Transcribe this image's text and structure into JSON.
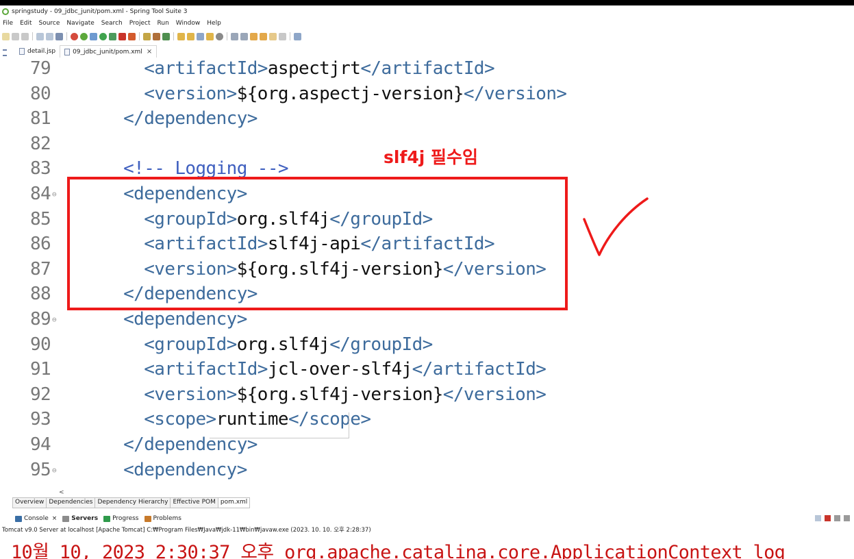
{
  "window": {
    "title": "springstudy - 09_jdbc_junit/pom.xml - Spring Tool Suite 3"
  },
  "menu": [
    "File",
    "Edit",
    "Source",
    "Navigate",
    "Search",
    "Project",
    "Run",
    "Window",
    "Help"
  ],
  "editor_tabs": [
    {
      "label": "detail.jsp",
      "active": false,
      "closable": false
    },
    {
      "label": "09_jdbc_junit/pom.xml",
      "active": true,
      "closable": true,
      "close_glyph": "×"
    }
  ],
  "code_lines": [
    {
      "num": "79",
      "fold": false,
      "indent": "    ",
      "parts": [
        [
          "tag",
          "<artifactId>"
        ],
        [
          "txt",
          "aspectjrt"
        ],
        [
          "tag",
          "</artifactId>"
        ]
      ]
    },
    {
      "num": "80",
      "fold": false,
      "indent": "    ",
      "parts": [
        [
          "tag",
          "<version>"
        ],
        [
          "txt",
          "${org.aspectj-version}"
        ],
        [
          "tag",
          "</version>"
        ]
      ]
    },
    {
      "num": "81",
      "fold": false,
      "indent": "  ",
      "parts": [
        [
          "tag",
          "</dependency>"
        ]
      ]
    },
    {
      "num": "82",
      "fold": false,
      "indent": "",
      "parts": []
    },
    {
      "num": "83",
      "fold": false,
      "indent": "  ",
      "parts": [
        [
          "cmt",
          "<!-- Logging -->"
        ]
      ]
    },
    {
      "num": "84",
      "fold": true,
      "indent": "  ",
      "parts": [
        [
          "tag",
          "<dependency>"
        ]
      ]
    },
    {
      "num": "85",
      "fold": false,
      "indent": "    ",
      "parts": [
        [
          "tag",
          "<groupId>"
        ],
        [
          "txt",
          "org.slf4j"
        ],
        [
          "tag",
          "</groupId>"
        ]
      ]
    },
    {
      "num": "86",
      "fold": false,
      "indent": "    ",
      "parts": [
        [
          "tag",
          "<artifactId>"
        ],
        [
          "txt",
          "slf4j-api"
        ],
        [
          "tag",
          "</artifactId>"
        ]
      ]
    },
    {
      "num": "87",
      "fold": false,
      "indent": "    ",
      "parts": [
        [
          "tag",
          "<version>"
        ],
        [
          "txt",
          "${org.slf4j-version}"
        ],
        [
          "tag",
          "</version>"
        ]
      ]
    },
    {
      "num": "88",
      "fold": false,
      "indent": "  ",
      "parts": [
        [
          "tag",
          "</dependency>"
        ]
      ]
    },
    {
      "num": "89",
      "fold": true,
      "indent": "  ",
      "parts": [
        [
          "tag",
          "<dependency>"
        ]
      ]
    },
    {
      "num": "90",
      "fold": false,
      "indent": "    ",
      "parts": [
        [
          "tag",
          "<groupId>"
        ],
        [
          "txt",
          "org.slf4j"
        ],
        [
          "tag",
          "</groupId>"
        ]
      ]
    },
    {
      "num": "91",
      "fold": false,
      "indent": "    ",
      "parts": [
        [
          "tag",
          "<artifactId>"
        ],
        [
          "txt",
          "jcl-over-slf4j"
        ],
        [
          "tag",
          "</artifactId>"
        ]
      ]
    },
    {
      "num": "92",
      "fold": false,
      "indent": "    ",
      "parts": [
        [
          "tag",
          "<version>"
        ],
        [
          "txt",
          "${org.slf4j-version}"
        ],
        [
          "tag",
          "</version>"
        ]
      ]
    },
    {
      "num": "93",
      "fold": false,
      "indent": "    ",
      "parts": [
        [
          "tag",
          "<scope>"
        ],
        [
          "txt",
          "runtime"
        ],
        [
          "tag",
          "</scope>"
        ]
      ]
    },
    {
      "num": "94",
      "fold": false,
      "indent": "  ",
      "parts": [
        [
          "tag",
          "</dependency>"
        ]
      ]
    },
    {
      "num": "95",
      "fold": true,
      "indent": "  ",
      "parts": [
        [
          "tag",
          "<dependency>"
        ]
      ]
    }
  ],
  "annotation": {
    "text": "slf4j 필수임",
    "color": "#ee1a1a"
  },
  "pom_tabs": [
    "Overview",
    "Dependencies",
    "Dependency Hierarchy",
    "Effective POM",
    "pom.xml"
  ],
  "hscroll_glyph": "<",
  "console": {
    "tabs": [
      {
        "label": "Console",
        "close": "×",
        "icon_color": "#3a6ea5"
      },
      {
        "label": "Servers",
        "bold": true,
        "icon_color": "#8c8c8c"
      },
      {
        "label": "Progress",
        "icon_color": "#2f9a4b"
      },
      {
        "label": "Problems",
        "icon_color": "#c77a2b"
      }
    ],
    "path": "Tomcat v9.0 Server at localhost [Apache Tomcat] C:₩Program Files₩Java₩jdk-11₩bin₩javaw.exe  (2023. 10. 10. 오후 2:28:37)",
    "log_line": "10월 10, 2023 2:30:37 오후 org.apache.catalina.core.ApplicationContext log"
  },
  "icons": {
    "app": "spring-tool-suite-icon",
    "check": "red-checkmark-annotation"
  }
}
